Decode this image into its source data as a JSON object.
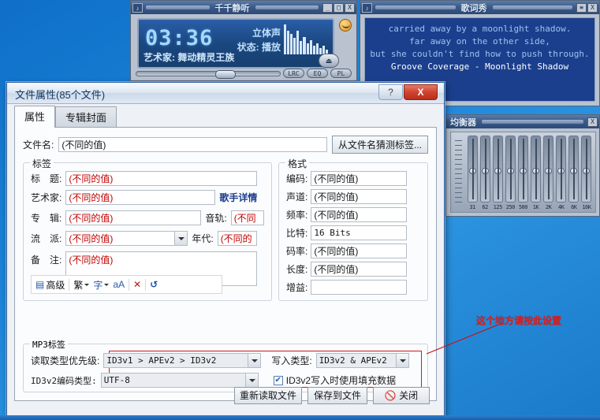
{
  "desktop": {
    "bg_color": "#1b84d8"
  },
  "player": {
    "title": "千千静听",
    "icon": "note-icon",
    "time": "03:36",
    "stereo_label": "立体声",
    "status_label": "状态:",
    "status_value": "播放",
    "artist_label": "艺术家:",
    "artist_value": "舞动精灵王族",
    "buttons": {
      "minimize": "_",
      "maximize": "□",
      "close": "X"
    },
    "mini_buttons": [
      "LRC",
      "EQ",
      "PL"
    ],
    "eject_icon": "eject-icon",
    "vu_levels": [
      38,
      30,
      26,
      21,
      30,
      17,
      22,
      14,
      18,
      11,
      14,
      8,
      11,
      6
    ]
  },
  "lyrics": {
    "title": "歌词秀",
    "buttons": {
      "shade": "≡",
      "close": "X"
    },
    "lines": [
      "carried away by a moonlight shadow.",
      "far away on the other side,",
      "but she couldn't find how to push through."
    ],
    "current_line": "Groove Coverage - Moonlight Shadow"
  },
  "equalizer": {
    "title": "均衡器",
    "close_label": "X",
    "bands": [
      "31",
      "62",
      "125",
      "250",
      "500",
      "1K",
      "2K",
      "4K",
      "6K",
      "16K"
    ]
  },
  "dialog": {
    "title": "文件属性(85个文件)",
    "help_label": "?",
    "close_label": "X",
    "tabs": [
      {
        "label": "属性",
        "active": true
      },
      {
        "label": "专辑封面",
        "active": false
      }
    ],
    "filename": {
      "label": "文件名:",
      "value": "(不同的值)",
      "guess_button": "从文件名猜测标签..."
    },
    "tag_group": {
      "legend": "标签",
      "fields": [
        {
          "label": "标　题:",
          "value": "(不同的值)"
        },
        {
          "label": "艺术家:",
          "value": "(不同的值)"
        },
        {
          "label": "专　辑:",
          "value": "(不同的值)"
        },
        {
          "label": "流　派:",
          "value": "(不同的值)"
        },
        {
          "label": "备　注:",
          "value": "(不同的值)"
        }
      ],
      "artist_link": "歌手详情",
      "track_label": "音轨:",
      "track_value": "(不同",
      "year_label": "年代:",
      "year_value": "(不同的",
      "toolbar": [
        {
          "name": "advanced",
          "label": "高级",
          "icon": "edit-note-icon"
        },
        {
          "name": "traditional",
          "label": "繁",
          "icon": "chevron-down-icon"
        },
        {
          "name": "spellcheck",
          "label": "",
          "icon": "spellcheck-icon"
        },
        {
          "name": "case-convert",
          "label": "",
          "icon": "case-convert-icon"
        },
        {
          "name": "clear",
          "label": "",
          "icon": "clear-x-icon"
        },
        {
          "name": "reset",
          "label": "",
          "icon": "refresh-icon"
        }
      ]
    },
    "format_group": {
      "legend": "格式",
      "fields": [
        {
          "label": "编码:",
          "value": "(不同的值)"
        },
        {
          "label": "声道:",
          "value": "(不同的值)"
        },
        {
          "label": "频率:",
          "value": "(不同的值)"
        },
        {
          "label": "比特:",
          "value": "16 Bits"
        },
        {
          "label": "码率:",
          "value": "(不同的值)"
        },
        {
          "label": "长度:",
          "value": "(不同的值)"
        },
        {
          "label": "增益:",
          "value": ""
        }
      ]
    },
    "mp3_group": {
      "legend": "MP3标签",
      "read_priority_label": "读取类型优先级:",
      "read_priority_value": "ID3v1 > APEv2 > ID3v2",
      "write_type_label": "写入类型:",
      "write_type_value": "ID3v2 & APEv2",
      "id3v2_encoding_label": "ID3v2编码类型:",
      "id3v2_encoding_value": "UTF-8",
      "padding_checkbox_label": "ID3v2写入时使用填充数据",
      "padding_checked": true
    },
    "footer_buttons": [
      {
        "name": "reload-file",
        "label": "重新读取文件"
      },
      {
        "name": "save-to-file",
        "label": "保存到文件"
      },
      {
        "name": "close",
        "label": "关闭",
        "icon": "prohibition-icon"
      }
    ]
  },
  "annotation": {
    "text": "这个地方请按此设置",
    "color": "#e01b1b"
  }
}
